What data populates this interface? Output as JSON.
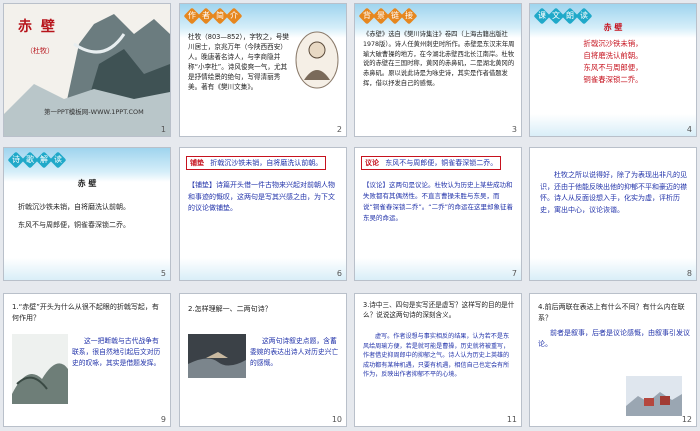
{
  "slides": [
    {
      "num": "1",
      "title": "赤  壁",
      "author": "（杜牧）",
      "footer": "第一PPT模板网-WWW.1PPT.COM"
    },
    {
      "num": "2",
      "tag": [
        "作",
        "者",
        "简",
        "介"
      ],
      "text": "杜牧（803—852），字牧之，号樊川居士，京兆万年（今陕西西安）人。晚唐著名诗人，与李商隐并称“小李杜”。诗风俊爽一气，尤其是抒情绘景的绝句，写得清丽秀美。著有《樊川文集》。"
    },
    {
      "num": "3",
      "tag": [
        "背",
        "景",
        "链",
        "接"
      ],
      "text": "《赤壁》选自《樊川诗集注》卷四（上海古籍出版社1978版）。诗人任黄州刺史时所作。赤壁是东汉末年周瑜大破曹操的地方，在今湖北赤壁西北长江南岸。杜牧说的赤壁在三国时称，黄冈的赤鼻矶，二是湖北黄冈的赤鼻矶。原以说此诗是为咏史诗，其实是作者借题发挥，借以抒发自己的感慨。"
    },
    {
      "num": "4",
      "tag": [
        "课",
        "文",
        "朗",
        "读"
      ],
      "title": "赤  壁",
      "lines": [
        "折戟沉沙铁未销，",
        "自将磨洗认前朝。",
        "东风不与周郎便，",
        "铜雀春深锁二乔。"
      ]
    },
    {
      "num": "5",
      "tag": [
        "诗",
        "歌",
        "解",
        "读"
      ],
      "title": "赤  壁",
      "lines": [
        "折戟沉沙铁未销，自将磨洗认前朝。",
        "东风不与周郎便，铜雀春深锁二乔。"
      ]
    },
    {
      "num": "6",
      "label": "铺垫",
      "headline": "折戟沉沙铁未销，自将磨洗认前朝。",
      "text": "【铺垫】诗篇开头借一件古物来兴起对前朝人物和事迹的慨叹，这两句是写其兴感之由，为下文的议论做铺垫。"
    },
    {
      "num": "7",
      "label": "议论",
      "headline": "东风不与周郎便，铜雀春深锁二乔。",
      "text": "【议论】这两句是议论。杜牧认为历史上某些成功和失败都有其偶然性。不直言曹操未胜与东吴，而说“铜雀春深锁二乔”。“二乔”的命运在这里却象征着东吴的命运。"
    },
    {
      "num": "8",
      "text": "杜牧之所以说得好，除了为表现出非凡的见识，还由于他能反映出他的抑郁不平和豪迈的襟怀。诗人从反面设想入手，化实为虚，评析历史，寓出中心，议论诙谐。"
    },
    {
      "num": "9",
      "question": "1.“赤壁”开头为什么从很不起眼的折戟写起，有何作用？",
      "answer": "这一把断戟与古代战争有联系，很自然地引起后文对历史的叹咏，其实是借题发挥。"
    },
    {
      "num": "10",
      "question": "2.怎样理解一、二两句诗？",
      "answer": "这两句诗叙史点题，含蓄委婉的表达出诗人对历史兴亡的感慨。"
    },
    {
      "num": "11",
      "question": "3.诗中三、四句是实写还是虚写？这样写的目的是什么？说说这两句诗的深刻含义。",
      "answer": "虚写。作者设想与事实相反的结果，认为若不是东风给周瑜方便，若是就可能是曹操，历史就将被重写，作者借史抑周郎中的抑郁之气。诗人认为历史上英雄的成功都有某种机遇，只要有机遇，相信自己也定会有所作为，反映出作者抑郁不平的心境。"
    },
    {
      "num": "12",
      "question": "4.前后两联在表达上有什么不同？有什么内在联系？",
      "answer": "前者是叙事，后者是议论感慨，由叙事引发议论。"
    }
  ]
}
